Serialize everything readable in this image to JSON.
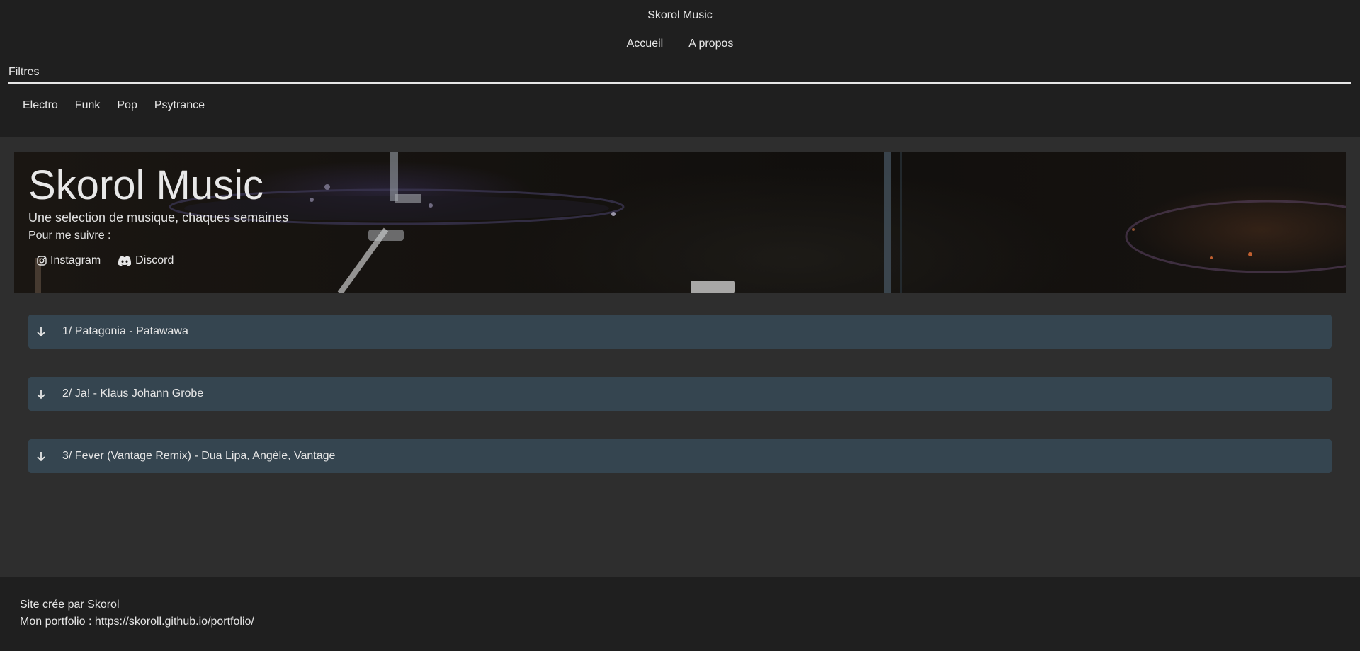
{
  "header": {
    "site_title": "Skorol Music",
    "nav": [
      "Accueil",
      "A propos"
    ],
    "filters_label": "Filtres",
    "filters": [
      "Electro",
      "Funk",
      "Pop",
      "Psytrance"
    ]
  },
  "hero": {
    "title": "Skorol Music",
    "subtitle": "Une selection de musique, chaques semaines",
    "follow_label": "Pour me suivre :",
    "socials": [
      {
        "icon": "instagram-icon",
        "label": "Instagram"
      },
      {
        "icon": "discord-icon",
        "label": "Discord"
      }
    ]
  },
  "tracks": [
    {
      "icon": "arrow-down-icon",
      "title": "1/ Patagonia - Patawawa"
    },
    {
      "icon": "arrow-down-icon",
      "title": "2/ Ja! - Klaus Johann Grobe"
    },
    {
      "icon": "arrow-down-icon",
      "title": "3/ Fever (Vantage Remix) - Dua Lipa, Angèle, Vantage"
    }
  ],
  "footer": {
    "credit": "Site crée par Skorol",
    "portfolio": "Mon portfolio : https://skoroll.github.io/portfolio/"
  },
  "colors": {
    "header_bg": "#1f1f1f",
    "page_bg": "#2e2e2e",
    "track_bg": "#354550",
    "text": "#e6e6e6"
  }
}
